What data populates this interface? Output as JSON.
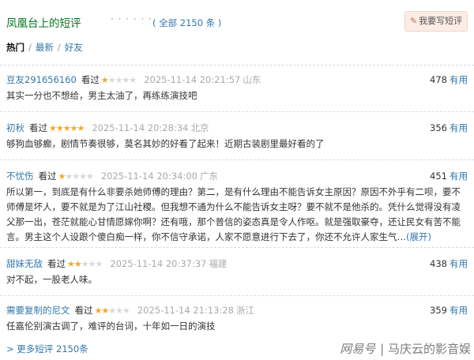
{
  "header": {
    "title": "凤凰台上的短评",
    "dots": "· · · · · ·",
    "count": "( 全部 2150 条 )",
    "write_button": "我要写短评"
  },
  "tabs": {
    "hot": "热门",
    "latest": "最新",
    "friends": "好友",
    "separator": "/"
  },
  "reviews": [
    {
      "user": "豆友291656160",
      "seen": "看过",
      "rating": 1,
      "time": "2025-11-14 20:21:57",
      "location": "山东",
      "votes": "478",
      "useful": "有用",
      "text": "其实一分也不想给，男主太油了，再练练演技吧"
    },
    {
      "user": "初秋",
      "seen": "看过",
      "rating": 5,
      "time": "2025-11-14 20:28:34",
      "location": "北京",
      "votes": "356",
      "useful": "有用",
      "text": "够狗血够癫，剧情节奏很够，莫名其妙的好看了起来！近期古装剧里最好看的了"
    },
    {
      "user": "不忧伤",
      "seen": "看过",
      "rating": 1,
      "time": "2025-11-14 20:34:00",
      "location": "广东",
      "votes": "451",
      "useful": "有用",
      "text": "所以第一，到底是有什么非要杀她师傅的理由？第二，是有什么理由不能告诉女主原因？原因不外乎有二呗，要不师傅是坏人，要不就是为了江山社稷。但我想不通为什么不能告诉女主呀？要不就不是他杀的。凭什么觉得没有凌父那一出，苍茫就能心甘情愿嫁你啊？还有哦，那个普信的姿态真是令人作呕。就是强取豪夺，还让民女有苦不能言。男主这个人设跟个傻白痴一样，你不信守承诺，人家不愿意进行下去了，你还不允许人家生气…",
      "expand": "(展开)"
    },
    {
      "user": "甜妹无敌",
      "seen": "看过",
      "rating": 2,
      "time": "2025-11-14 20:37:37",
      "location": "福建",
      "votes": "438",
      "useful": "有用",
      "text": "对不起，一股老人味。"
    },
    {
      "user": "需要复制的尼文",
      "seen": "看过",
      "rating": 2,
      "time": "2025-11-14 21:13:28",
      "location": "浙江",
      "votes": "359",
      "useful": "有用",
      "text": "任嘉伦别演古调了，难评的台词，十年如一日的演技"
    }
  ],
  "more_link": "> 更多短评 2150条",
  "watermark": {
    "logo": "网易号",
    "separator": "|",
    "author": "马庆云的影音娱"
  },
  "colors": {
    "title_green": "#007722",
    "link_blue": "#3377aa",
    "star_orange": "#f8a62a",
    "button_bg": "#fbece4"
  }
}
